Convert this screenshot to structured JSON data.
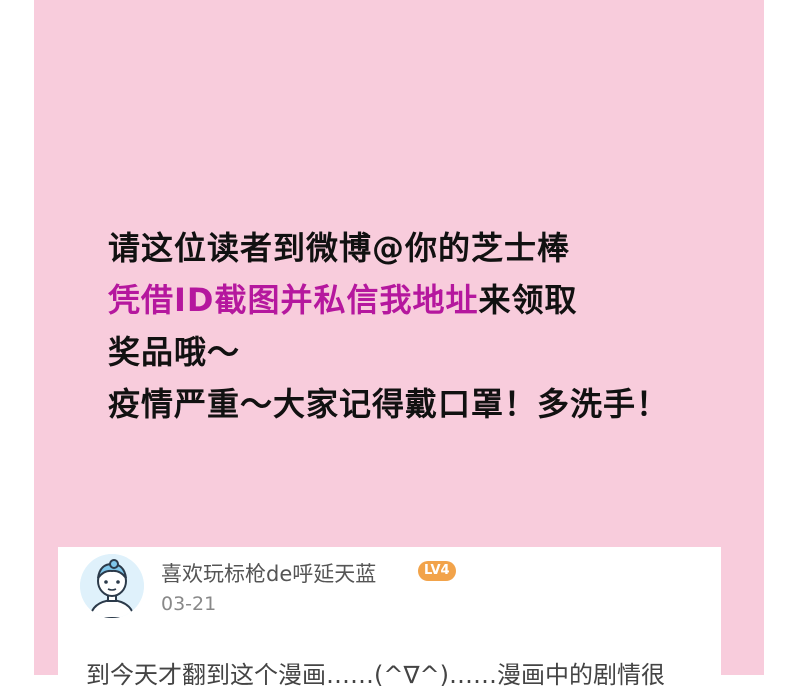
{
  "announcement": {
    "line1": "请这位读者到微博@你的芝士棒",
    "line2_highlight": "凭借ID截图并私信我地址",
    "line2_rest": "来领取",
    "line3": "奖品哦～",
    "line4": "疫情严重～大家记得戴口罩！多洗手！"
  },
  "comment_card": {
    "username": "喜欢玩标枪de呼延天蓝",
    "level_badge": "LV4",
    "date": "03-21",
    "body_partial": "到今天才翻到这个漫画……(^∇^)……漫画中的剧情很"
  },
  "colors": {
    "panel_background": "#f8ccdc",
    "highlight_text": "#b5179e",
    "badge": "#f2a34a"
  }
}
